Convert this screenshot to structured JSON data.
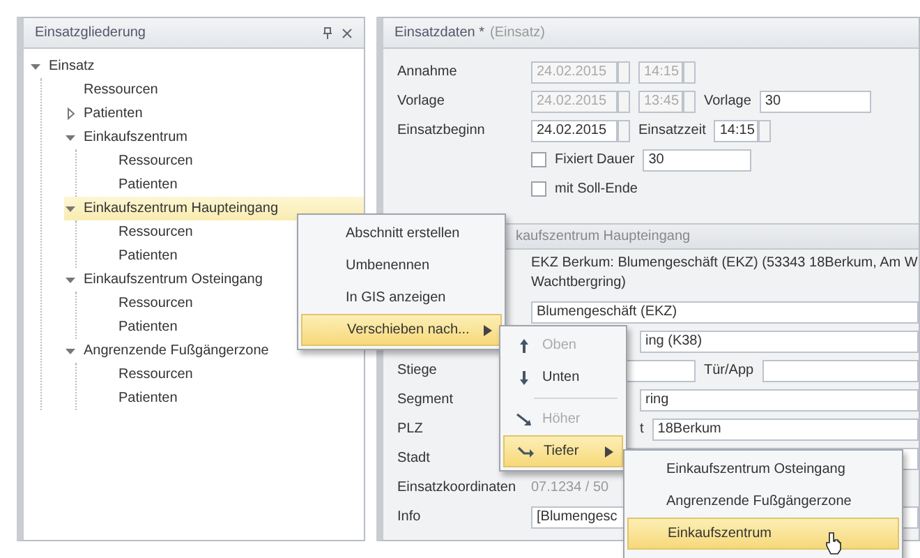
{
  "tree_panel": {
    "title": "Einsatzgliederung",
    "tree": [
      {
        "label": "Einsatz",
        "expanded": true,
        "selected": false,
        "children": [
          {
            "label": "Ressourcen",
            "selected": false
          },
          {
            "label": "Patienten",
            "expanded": false,
            "selected": false
          },
          {
            "label": "Einkaufszentrum",
            "expanded": true,
            "selected": false,
            "children": [
              {
                "label": "Ressourcen",
                "selected": false
              },
              {
                "label": "Patienten",
                "selected": false
              }
            ]
          },
          {
            "label": "Einkaufszentrum Haupteingang",
            "expanded": true,
            "selected": true,
            "children": [
              {
                "label": "Ressourcen",
                "selected": false
              },
              {
                "label": "Patienten",
                "selected": false
              }
            ]
          },
          {
            "label": "Einkaufszentrum Osteingang",
            "expanded": true,
            "selected": false,
            "children": [
              {
                "label": "Ressourcen",
                "selected": false
              },
              {
                "label": "Patienten",
                "selected": false
              }
            ]
          },
          {
            "label": "Angrenzende Fußgängerzone",
            "expanded": true,
            "selected": false,
            "children": [
              {
                "label": "Ressourcen",
                "selected": false
              },
              {
                "label": "Patienten",
                "selected": false
              }
            ]
          }
        ]
      }
    ]
  },
  "detail_panel": {
    "title": "Einsatzdaten *",
    "subtitle": "(Einsatz)",
    "times": [
      {
        "label": "Annahme",
        "date": "24.02.2015",
        "time": "14:15",
        "disabled": true
      },
      {
        "label": "Vorlage",
        "date": "24.02.2015",
        "time": "13:45",
        "disabled": true,
        "extra_label": "Vorlage",
        "extra_value": "30"
      },
      {
        "label": "Einsatzbeginn",
        "date": "24.02.2015",
        "time_label": "Einsatzzeit",
        "time": "14:15",
        "disabled": false
      }
    ],
    "options": [
      {
        "label": "Fixiert Dauer",
        "checked": false,
        "value": "30"
      },
      {
        "label": "mit Soll-Ende",
        "checked": false
      }
    ],
    "section": {
      "title": "kaufszentrum Haupteingang",
      "address_lines": [
        "EKZ Berkum: Blumengeschäft (EKZ) (53343 18Berkum, Am W",
        "Wachtbergring)"
      ],
      "rows": [
        {
          "kind": "field",
          "value": "Blumengeschäft (EKZ)"
        },
        {
          "kind": "partial",
          "value": "ing (K38)"
        },
        {
          "kind": "field",
          "label": "Stiege",
          "label2": "Tür/App"
        },
        {
          "kind": "partial",
          "label": "Segment",
          "value": "ring"
        },
        {
          "kind": "partial",
          "label": "PLZ",
          "label2": "t",
          "value": "18Berkum"
        },
        {
          "kind": "field",
          "label": "Stadt"
        },
        {
          "kind": "text",
          "label": "Einsatzkoordinaten",
          "value": "07.1234 / 50"
        },
        {
          "kind": "field",
          "label": "Info",
          "value": "[Blumengesc"
        }
      ]
    }
  },
  "context_menu": [
    {
      "label": "Abschnitt erstellen",
      "selected": false,
      "submenu": false
    },
    {
      "label": "Umbenennen",
      "selected": false,
      "submenu": false
    },
    {
      "label": "In GIS anzeigen",
      "selected": false,
      "submenu": false
    },
    {
      "label": "Verschieben nach...",
      "selected": true,
      "submenu": true
    }
  ],
  "move_menu": [
    {
      "kind": "up",
      "label": "Oben",
      "disabled": true,
      "selected": false,
      "submenu": false
    },
    {
      "kind": "down",
      "label": "Unten",
      "disabled": false,
      "selected": false,
      "submenu": false
    },
    {
      "kind": "separator"
    },
    {
      "kind": "higher",
      "label": "Höher",
      "disabled": true,
      "selected": false,
      "submenu": false
    },
    {
      "kind": "lower",
      "label": "Tiefer",
      "disabled": false,
      "selected": true,
      "submenu": true
    }
  ],
  "target_menu": [
    {
      "label": "Einkaufszentrum Osteingang",
      "selected": false
    },
    {
      "label": "Angrenzende Fußgängerzone",
      "selected": false
    },
    {
      "label": "Einkaufszentrum",
      "selected": true
    }
  ]
}
